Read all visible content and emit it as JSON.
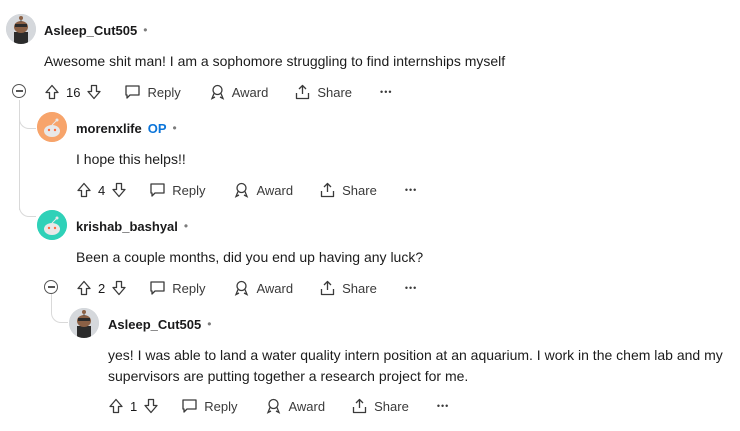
{
  "comments": [
    {
      "author": "Asleep_Cut505",
      "dot": "•",
      "text": "Awesome shit man! I am a sophomore struggling to find internships myself",
      "votes": "16",
      "reply": "Reply",
      "award": "Award",
      "share": "Share",
      "more": "•••"
    },
    {
      "author": "morenxlife",
      "op": "OP",
      "dot": "•",
      "text": "I hope this helps!!",
      "votes": "4",
      "reply": "Reply",
      "award": "Award",
      "share": "Share",
      "more": "•••"
    },
    {
      "author": "krishab_bashyal",
      "dot": "•",
      "text": "Been a couple months, did you end up having any luck?",
      "votes": "2",
      "reply": "Reply",
      "award": "Award",
      "share": "Share",
      "more": "•••"
    },
    {
      "author": "Asleep_Cut505",
      "dot": "•",
      "text": "yes! I was able to land a water quality intern position at an aquarium. I work in the chem lab and my supervisors are putting together a research project for me.",
      "votes": "1",
      "reply": "Reply",
      "award": "Award",
      "share": "Share",
      "more": "•••"
    }
  ],
  "colors": {
    "op": "#0a74d9",
    "thread": "#d9d9d9",
    "avatar_morenx": "#f7a46b",
    "avatar_krishab": "#2fd1b8"
  }
}
